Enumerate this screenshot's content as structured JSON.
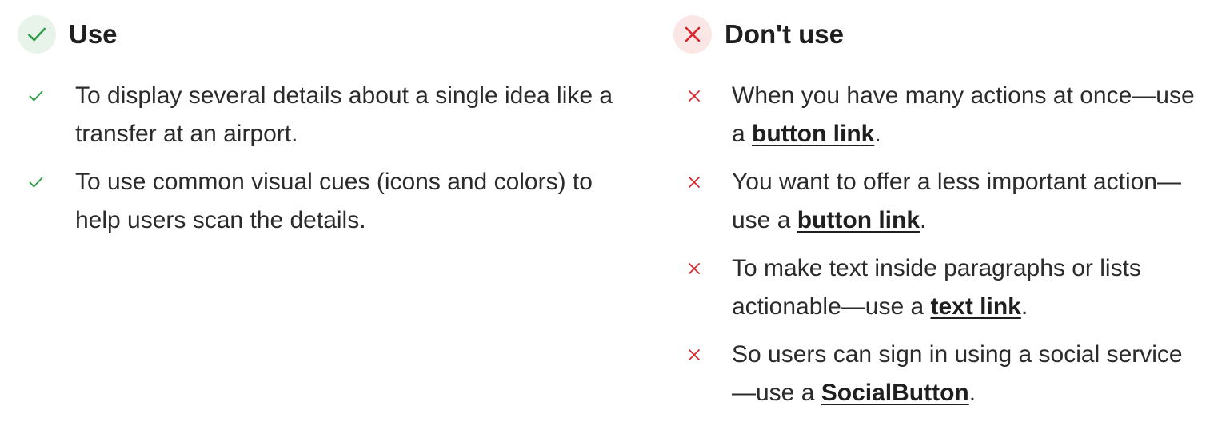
{
  "use": {
    "title": "Use",
    "icon": "check-icon",
    "color": "#2e9b48",
    "items": [
      {
        "text": "To display several details about a single idea like a transfer at an airport."
      },
      {
        "text": "To use common visual cues (icons and colors) to help users scan the details."
      }
    ]
  },
  "dont": {
    "title": "Don't use",
    "icon": "close-icon",
    "color": "#d7262b",
    "items": [
      {
        "before": "When you have many actions at once—use a ",
        "link": "button link",
        "after": "."
      },
      {
        "before": "You want to offer a less important action—use a ",
        "link": "button link",
        "after": "."
      },
      {
        "before": "To make text inside paragraphs or lists actionable—use a ",
        "link": "text link",
        "after": "."
      },
      {
        "before": "So users can sign in using a social service—use a ",
        "link": "SocialButton",
        "after": "."
      }
    ]
  }
}
